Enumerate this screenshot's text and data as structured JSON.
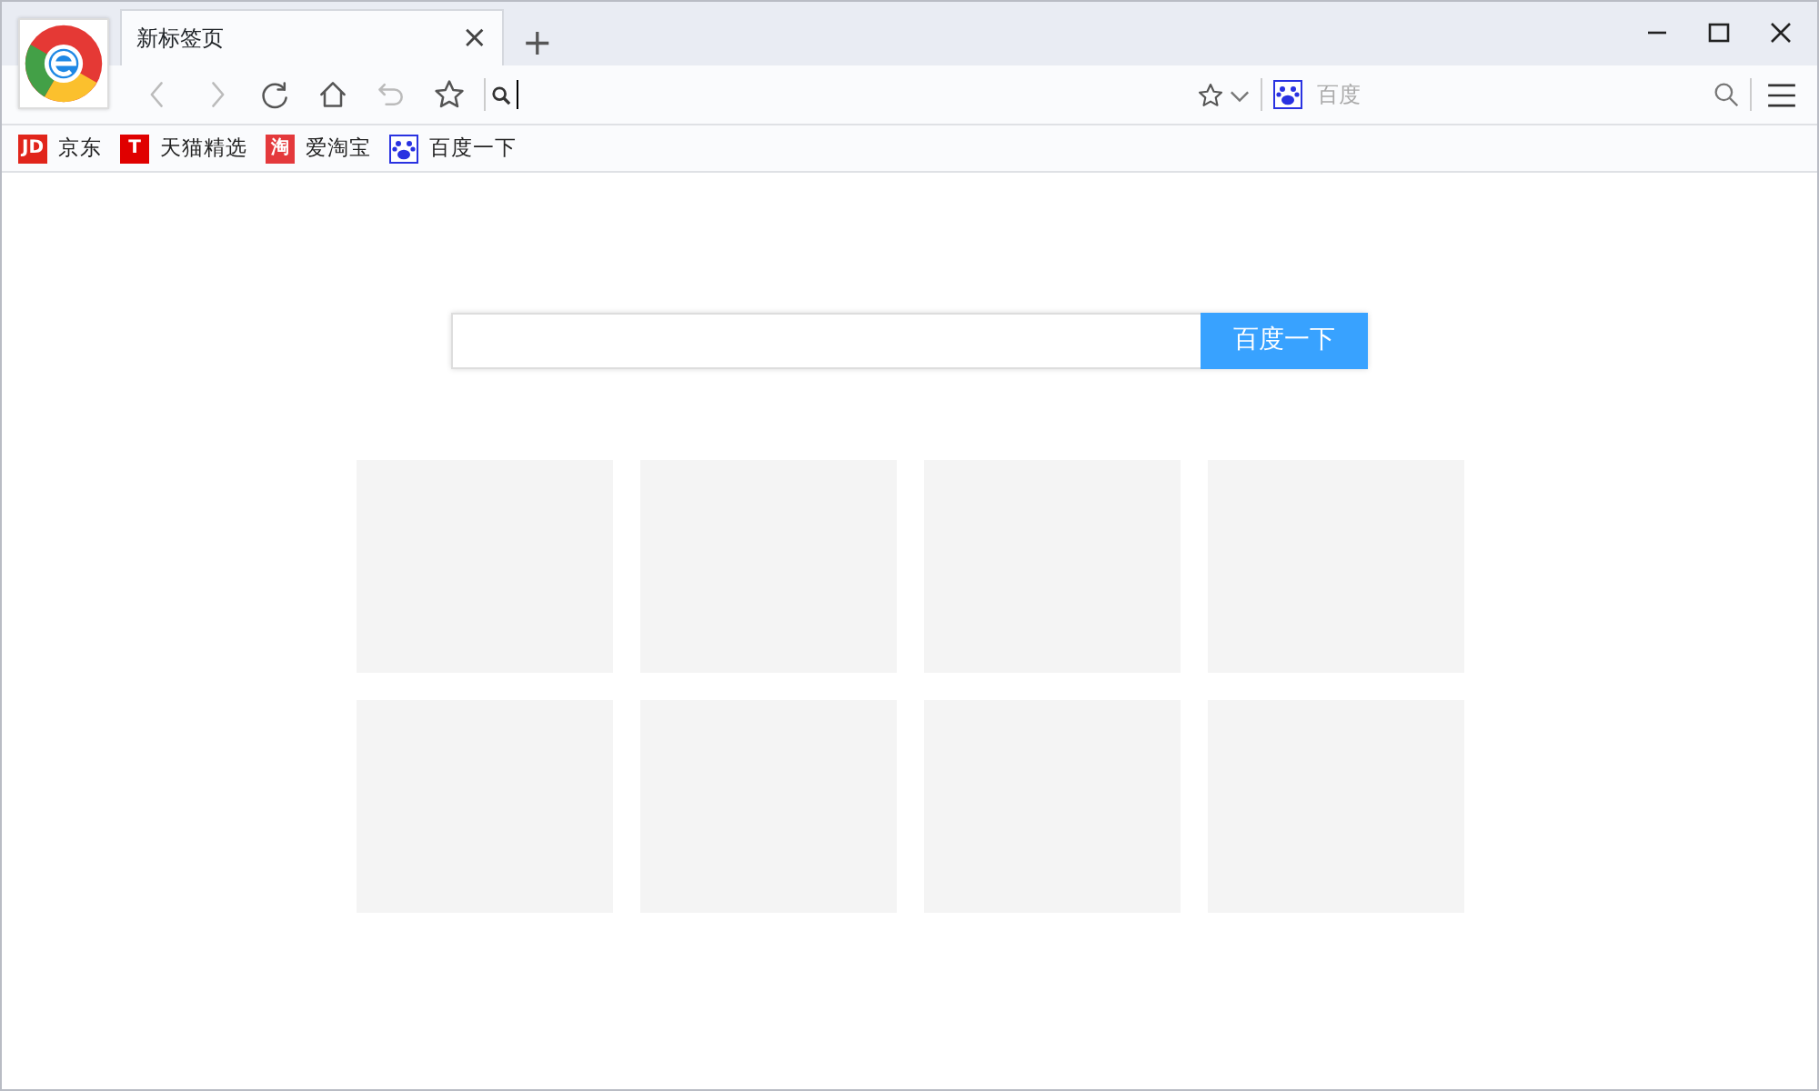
{
  "tabs": [
    {
      "title": "新标签页",
      "close": "×",
      "selected": true
    }
  ],
  "new_tab": "+",
  "address_bar": {
    "focused": true
  },
  "search_box": {
    "placeholder": "百度"
  },
  "bookmarks": [
    {
      "label": "京东",
      "icon_text": "JD",
      "color": "#e1251b"
    },
    {
      "label": "天猫精选",
      "icon_text": "T",
      "color": "#e00000"
    },
    {
      "label": "爱淘宝",
      "icon_text": "淘",
      "color": "#e4393c"
    },
    {
      "label": "百度一下",
      "kind": "paw",
      "color": "#2932e1"
    }
  ],
  "page_search": {
    "button": "百度一下"
  },
  "tiles": [
    {
      "kind": "blank"
    },
    {
      "kind": "blank"
    },
    {
      "kind": "blank"
    },
    {
      "kind": "blank"
    },
    {
      "kind": "blank"
    },
    {
      "kind": "blank"
    },
    {
      "kind": "blank"
    },
    {
      "kind": "blank"
    }
  ]
}
